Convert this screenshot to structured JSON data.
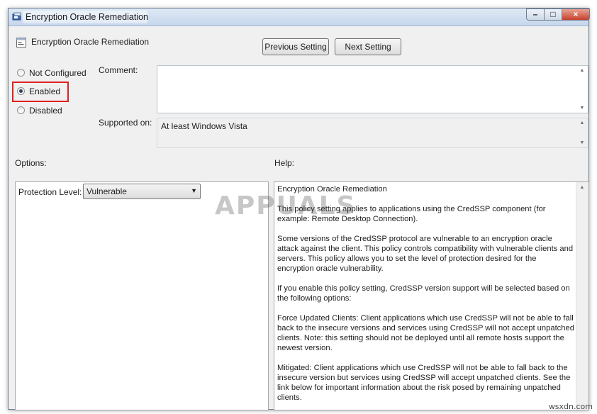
{
  "window": {
    "title": "Encryption Oracle Remediation",
    "caption_buttons": {
      "minimize": "–",
      "maximize": "□",
      "close": "×"
    }
  },
  "header": {
    "setting_name": "Encryption Oracle Remediation",
    "prev_button": "Previous Setting",
    "next_button": "Next Setting"
  },
  "state": {
    "options": [
      {
        "label": "Not Configured",
        "checked": false
      },
      {
        "label": "Enabled",
        "checked": true
      },
      {
        "label": "Disabled",
        "checked": false
      }
    ],
    "highlight_color": "#e01f1f"
  },
  "comment": {
    "label": "Comment:",
    "value": ""
  },
  "supported": {
    "label": "Supported on:",
    "value": "At least Windows Vista"
  },
  "options_section": {
    "label": "Options:",
    "protection_label": "Protection Level:",
    "protection_value": "Vulnerable"
  },
  "help_section": {
    "label": "Help:",
    "paragraphs": [
      "Encryption Oracle Remediation",
      "This policy setting applies to applications using the CredSSP component (for example: Remote Desktop Connection).",
      "Some versions of the CredSSP protocol are vulnerable to an encryption oracle attack against the client.  This policy controls compatibility with vulnerable clients and servers.  This policy allows you to set the level of protection desired for the encryption oracle vulnerability.",
      "If you enable this policy setting, CredSSP version support will be selected based on the following options:",
      "Force Updated Clients: Client applications which use CredSSP will not be able to fall back to the insecure versions and services using CredSSP will not accept unpatched clients. Note: this setting should not be deployed until all remote hosts support the newest version.",
      "Mitigated: Client applications which use CredSSP will not be able to fall back to the insecure version but services using CredSSP will accept unpatched clients. See the link below for important information about the risk posed by remaining unpatched clients."
    ]
  },
  "watermark": {
    "logo": "APPUALS",
    "site": "wsxdn.com"
  }
}
